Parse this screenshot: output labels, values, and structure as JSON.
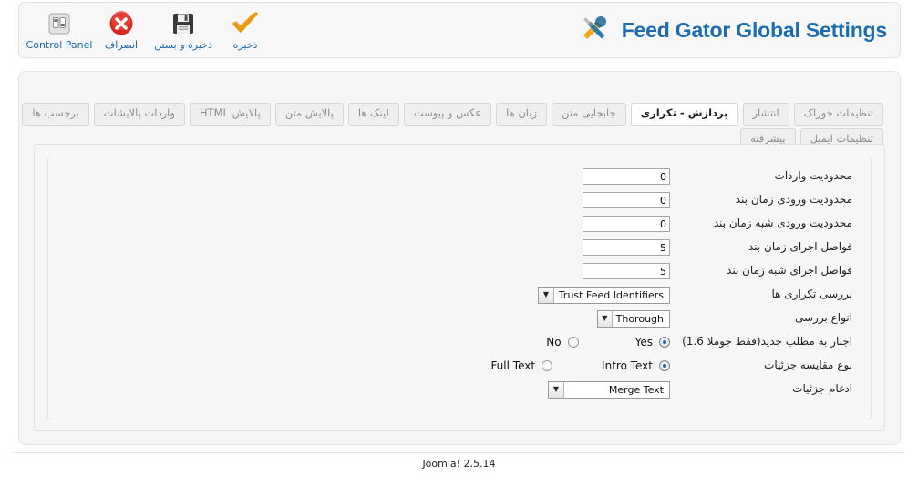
{
  "toolbar": {
    "buttons": [
      {
        "label": "ذخیره",
        "icon": "check-icon"
      },
      {
        "label": "ذخیره و بستن",
        "icon": "floppy-disk-icon"
      },
      {
        "label": "انصراف",
        "icon": "cancel-x-icon"
      },
      {
        "label": "Control Panel",
        "icon": "control-panel-icon"
      }
    ],
    "title": "Feed Gator Global Settings",
    "title_icon": "tools-wrench-screwdriver-icon",
    "title_color": "#1c6cb0"
  },
  "tabs": {
    "row1": [
      {
        "label": "تنظیمات خوراک",
        "active": false
      },
      {
        "label": "انتشار",
        "active": false
      },
      {
        "label": "پردازش - تکراری",
        "active": true
      },
      {
        "label": "جابجایی متن",
        "active": false
      },
      {
        "label": "زبان ها",
        "active": false
      },
      {
        "label": "عکس و پیوست",
        "active": false
      },
      {
        "label": "لینک ها",
        "active": false
      },
      {
        "label": "پالایش متن",
        "active": false
      },
      {
        "label": "پالایش HTML",
        "active": false
      },
      {
        "label": "واردات پالایشات",
        "active": false
      },
      {
        "label": "برچسب ها",
        "active": false
      }
    ],
    "row2": [
      {
        "label": "تنظیمات ایمیل",
        "active": false
      },
      {
        "label": "پیشرفته",
        "active": false
      }
    ]
  },
  "form": {
    "rows": [
      {
        "label": "محدودیت واردات",
        "type": "number",
        "value": "0"
      },
      {
        "label": "محدودیت ورودی زمان بند",
        "type": "number",
        "value": "0"
      },
      {
        "label": "محدودیت ورودی شبه زمان بند",
        "type": "number",
        "value": "0"
      },
      {
        "label": "فواصل اجرای زمان بند",
        "type": "number",
        "value": "5"
      },
      {
        "label": "فواصل اجرای شبه زمان بند",
        "type": "number",
        "value": "5"
      },
      {
        "label": "بررسی تکراری ها",
        "type": "select",
        "value": "Trust Feed Identifiers"
      },
      {
        "label": "انواع بررسی",
        "type": "select",
        "value": "Thorough"
      },
      {
        "label": "اجبار به مطلب جدید(فقط جوملا 1.6)",
        "type": "radio",
        "options": [
          "Yes",
          "No"
        ],
        "selected": "Yes"
      },
      {
        "label": "نوع مقایسه جزئیات",
        "type": "radio",
        "options": [
          "Intro Text",
          "Full Text"
        ],
        "selected": "Intro Text"
      },
      {
        "label": "ادغام جزئیات",
        "type": "select",
        "value": "Merge Text"
      }
    ]
  },
  "footer": {
    "text": "Joomla! 2.5.14"
  }
}
